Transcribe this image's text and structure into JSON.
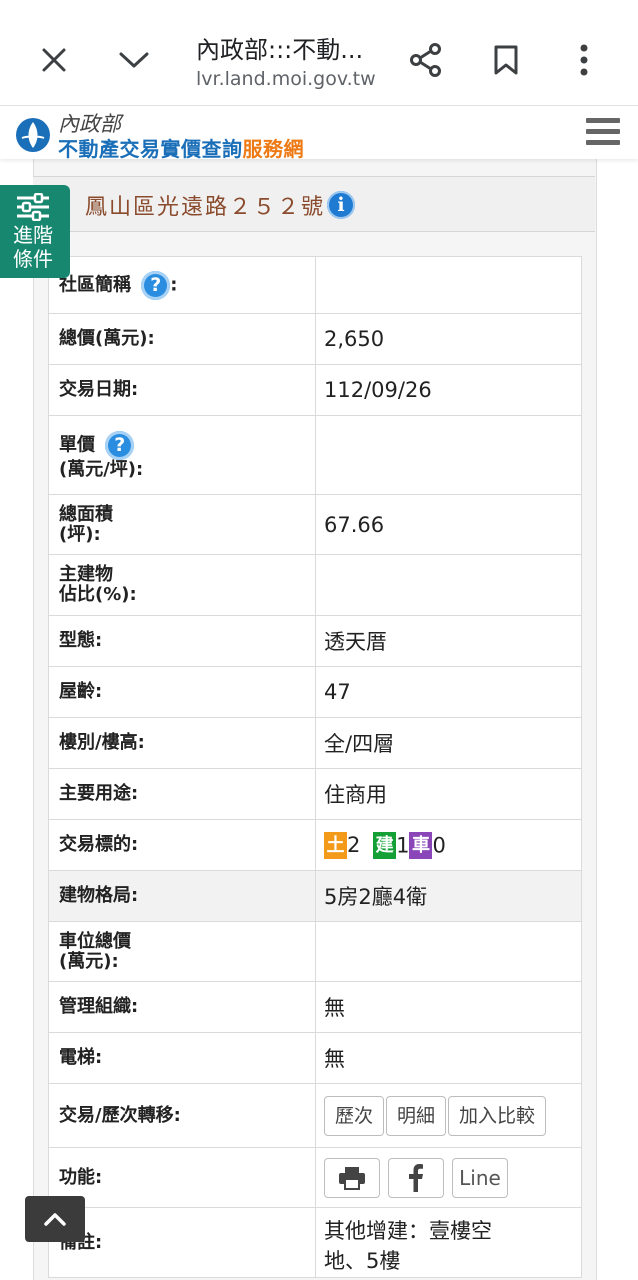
{
  "browser": {
    "title": "內政部:::不動...",
    "url": "lvr.land.moi.gov.tw"
  },
  "site": {
    "logo_top": "內政部",
    "logo_main": "不動產交易實價查詢",
    "logo_accent": "服務網"
  },
  "address": "鳳山區光遠路２５２號",
  "advanced": {
    "line1": "進階",
    "line2": "條件"
  },
  "rows": {
    "community": {
      "label": "社區簡稱",
      "colon": ":",
      "value": ""
    },
    "total_price": {
      "label": "總價(萬元):",
      "value": "2,650"
    },
    "trade_date": {
      "label": "交易日期:",
      "value": "112/09/26"
    },
    "unit_price": {
      "label": "單價",
      "label2": "(萬元/坪):",
      "value": ""
    },
    "total_area": {
      "label": "總面積",
      "label2": "(坪):",
      "value": "67.66"
    },
    "main_ratio": {
      "label": "主建物",
      "label2": "佔比(%):",
      "value": ""
    },
    "type": {
      "label": "型態:",
      "value": "透天厝"
    },
    "age": {
      "label": "屋齡:",
      "value": "47"
    },
    "floor": {
      "label": "樓別/樓高:",
      "value": "全/四層"
    },
    "usage": {
      "label": "主要用途:",
      "value": "住商用"
    },
    "target": {
      "label": "交易標的:",
      "land_badge": "土",
      "land_count": "2",
      "build_badge": "建",
      "build_count": "1",
      "car_badge": "車",
      "car_count": "0"
    },
    "layout": {
      "label": "建物格局:",
      "value": "5房2廳4衛"
    },
    "parking_price": {
      "label": "車位總價",
      "label2": "(萬元):",
      "value": ""
    },
    "management": {
      "label": "管理組織:",
      "value": "無"
    },
    "elevator": {
      "label": "電梯:",
      "value": "無"
    },
    "transfer": {
      "label": "交易/歷次轉移:",
      "btn_history": "歷次",
      "btn_detail": "明細",
      "btn_compare": "加入比較"
    },
    "functions": {
      "label": "功能:",
      "btn_line": "Line"
    },
    "remark": {
      "label": "備註:",
      "value_line1": "其他增建：壹樓空",
      "value_line2": "地、5樓"
    }
  },
  "colors": {
    "accent_green": "#17876f",
    "logo_blue": "#1b6fb8",
    "logo_orange": "#ee7a16",
    "address_brown": "#8a4a2c"
  }
}
